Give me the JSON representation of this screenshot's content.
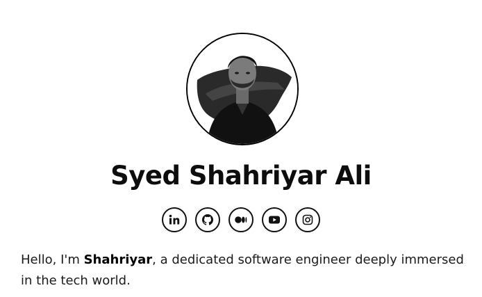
{
  "profile": {
    "name": "Syed Shahriyar Ali",
    "photo_alt": "Portrait of Syed Shahriyar Ali"
  },
  "socials": [
    {
      "label": "in",
      "icon": "linkedin-icon"
    },
    {
      "label": "",
      "icon": "github-icon"
    },
    {
      "label": "",
      "icon": "medium-icon"
    },
    {
      "label": "",
      "icon": "youtube-icon"
    },
    {
      "label": "",
      "icon": "instagram-icon"
    }
  ],
  "intro": {
    "prefix": "Hello, I'm ",
    "highlight": "Shahriyar",
    "suffix": ", a dedicated software engineer deeply immersed in the tech world."
  },
  "colors": {
    "text": "#111111",
    "background": "#ffffff",
    "accent": "#000000"
  }
}
